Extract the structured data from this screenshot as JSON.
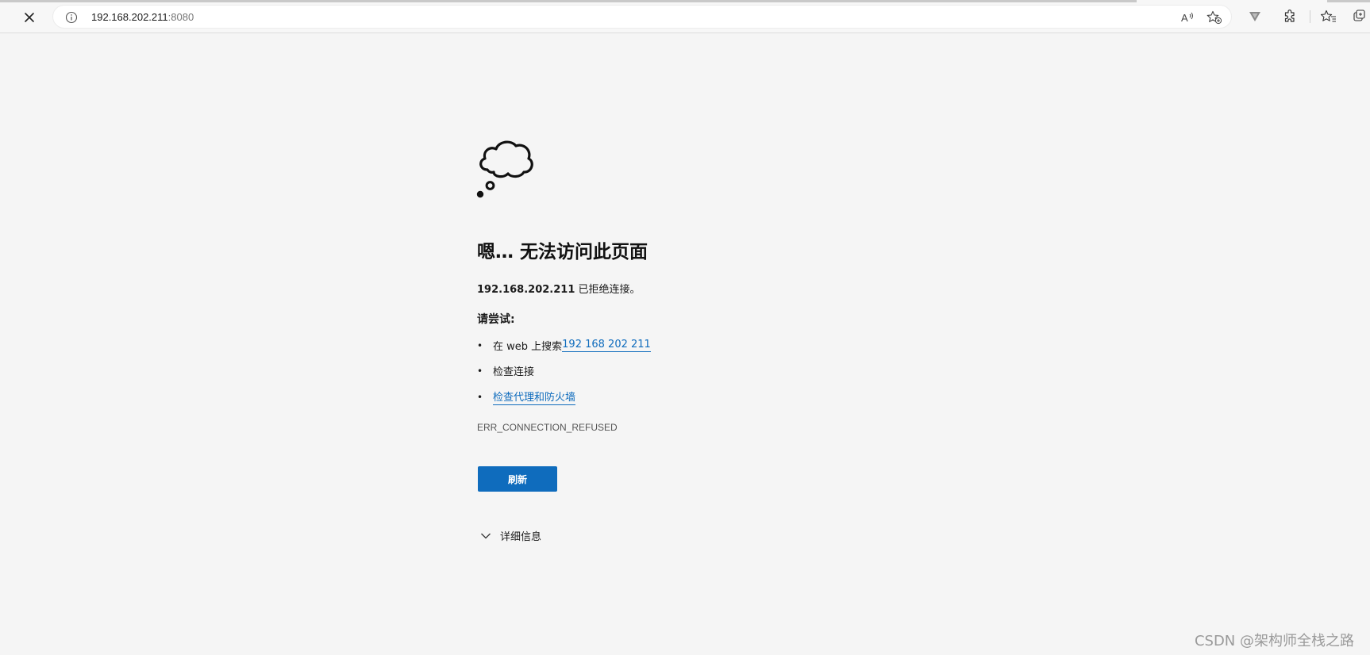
{
  "browser": {
    "url_host": "192.168.202.211",
    "url_port": ":8080",
    "icons": [
      "stop-icon",
      "site-info-icon",
      "read-aloud-icon",
      "add-favorite-icon",
      "extension-v-icon",
      "extensions-icon",
      "favorites-icon",
      "collections-icon"
    ]
  },
  "error": {
    "icon": "thought-cloud-icon",
    "heading": "嗯… 无法访问此页面",
    "host": "192.168.202.211",
    "refused_text": " 已拒绝连接。",
    "try_label": "请尝试:",
    "bullet": "•",
    "suggestions": [
      {
        "prefix": "在 web 上搜索 ",
        "link": "192 168 202 211"
      },
      {
        "prefix": "检查连接",
        "link": ""
      },
      {
        "prefix": "",
        "link": "检查代理和防火墙"
      }
    ],
    "error_code": "ERR_CONNECTION_REFUSED",
    "refresh_label": "刷新",
    "details_label": "详细信息"
  },
  "watermark": "CSDN @架构师全栈之路",
  "colors": {
    "link": "#0f6cbd",
    "button": "#0f6cbd",
    "page_bg": "#f5f5f5"
  }
}
